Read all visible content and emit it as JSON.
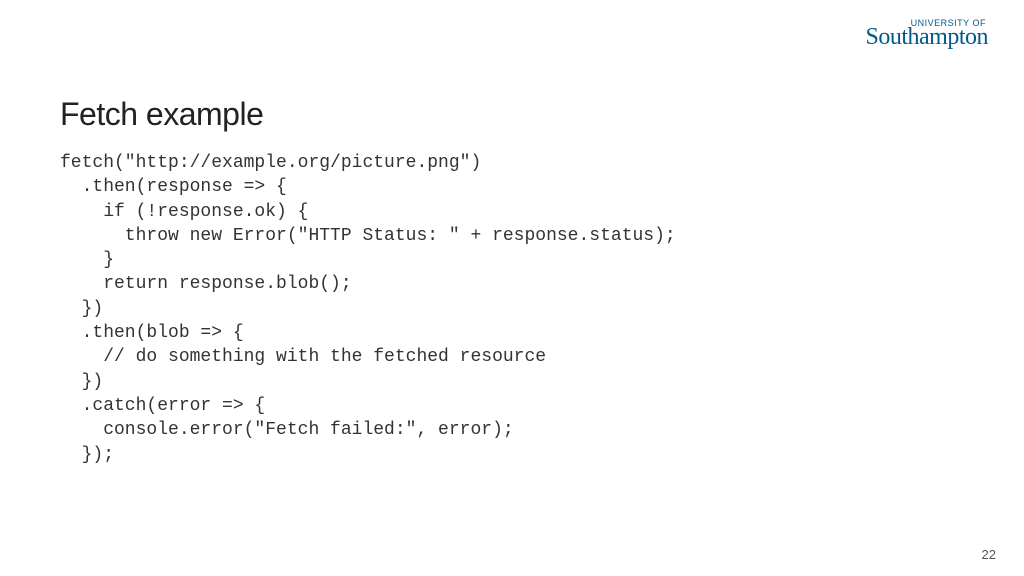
{
  "logo": {
    "top_text": "UNIVERSITY OF",
    "main_text": "Southampton"
  },
  "slide": {
    "title": "Fetch example",
    "code": "fetch(\"http://example.org/picture.png\")\n  .then(response => {\n    if (!response.ok) {\n      throw new Error(\"HTTP Status: \" + response.status);\n    }\n    return response.blob();\n  })\n  .then(blob => {\n    // do something with the fetched resource\n  })\n  .catch(error => {\n    console.error(\"Fetch failed:\", error);\n  });"
  },
  "page_number": "22"
}
